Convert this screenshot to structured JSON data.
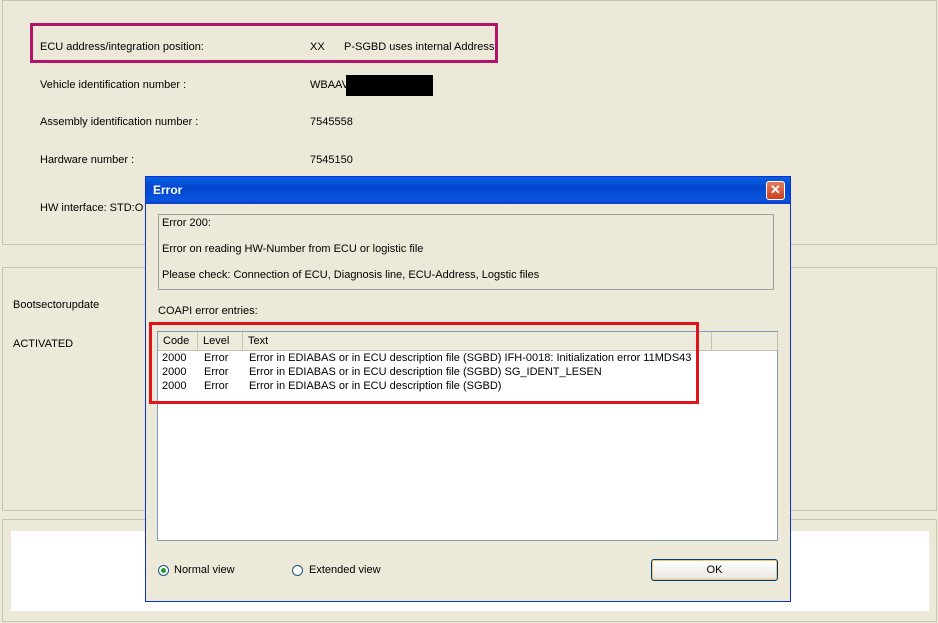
{
  "background": {
    "ecu_label": "ECU address/integration position:",
    "ecu_value": "XX",
    "ecu_note": "P-SGBD uses internal Address",
    "vin_label": "Vehicle identification number :",
    "vin_value": "WBAAV",
    "assembly_label": "Assembly identification number :",
    "assembly_value": "7545558",
    "hardware_label": "Hardware number :",
    "hardware_value": "7545150",
    "hw_interface_label": "HW interface:  STD:O",
    "bootsector_label": "Bootsectorupdate",
    "bootsector_value": "ACTIVATED"
  },
  "dialog": {
    "title": "Error",
    "close_glyph": "✕",
    "message_lines": [
      "Error 200:",
      "Error on reading HW-Number from ECU or logistic file",
      "Please check: Connection of ECU, Diagnosis line, ECU-Address, Logstic files"
    ],
    "coapi_label": "COAPI error entries:",
    "columns": [
      "Code",
      "Level",
      "Text"
    ],
    "rows": [
      {
        "code": "2000",
        "level": "Error",
        "text": "Error in EDIABAS or in ECU description file (SGBD)  IFH-0018: Initialization error  11MDS43"
      },
      {
        "code": "2000",
        "level": "Error",
        "text": "Error in EDIABAS or in ECU description file (SGBD)  SG_IDENT_LESEN"
      },
      {
        "code": "2000",
        "level": "Error",
        "text": "Error in EDIABAS or in ECU description file (SGBD)"
      }
    ],
    "radio_normal": "Normal view",
    "radio_extended": "Extended view",
    "selected_view": "Normal view",
    "ok_label": "OK"
  },
  "colors": {
    "highlight_purple": "#b4136b",
    "highlight_red": "#e0141c",
    "titlebar_blue": "#0346cf"
  }
}
